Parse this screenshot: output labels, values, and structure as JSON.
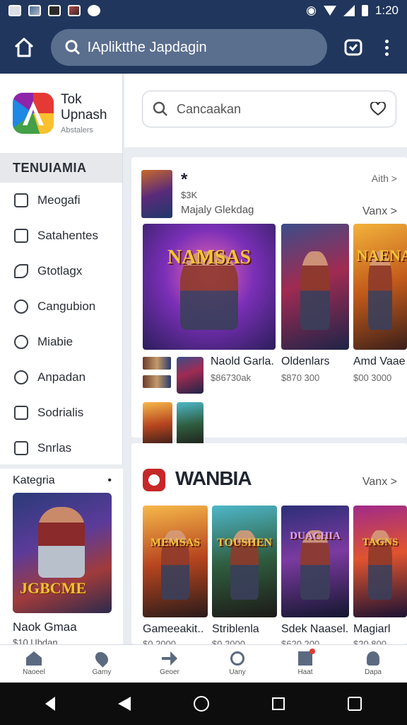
{
  "status": {
    "time": "1:20"
  },
  "appbar": {
    "search_text": "IApliktthe Japdagin"
  },
  "sidebar": {
    "brand_name_line1": "Tok",
    "brand_name_line2": "Upnash",
    "brand_sub": "Abstalers",
    "menu_title": "TENUIAMIA",
    "items": [
      {
        "label": "Meogafi",
        "icon": "checkbox-icon"
      },
      {
        "label": "Satahentes",
        "icon": "square-minus-icon"
      },
      {
        "label": "Gtotlagx",
        "icon": "pen-icon"
      },
      {
        "label": "Cangubion",
        "icon": "clock-icon"
      },
      {
        "label": "Miabie",
        "icon": "search-icon"
      },
      {
        "label": "Anpadan",
        "icon": "cloud-icon"
      },
      {
        "label": "Sodrialis",
        "icon": "dot-square-icon"
      },
      {
        "label": "Snrlas",
        "icon": "tag-icon"
      }
    ],
    "category": {
      "title": "Kategria",
      "cover_title": "JGBCME",
      "name": "Naok Gmaa",
      "price": "$10 Ubdan"
    }
  },
  "main": {
    "search_placeholder": "Cancaakan",
    "section1": {
      "title": "*",
      "subtitle": "$3K",
      "meta": "Majaly Glekdag",
      "more_top": "Aith >",
      "more": "Vanx >",
      "games": [
        {
          "art": "NAMSAS",
          "name": "Naold Garla.",
          "price": "$86730ak"
        },
        {
          "art": "",
          "name": "Oldenlars",
          "price": "$870 300"
        },
        {
          "art": "NAENA",
          "name": "Amd Vaae",
          "price": "$00 3000"
        }
      ]
    },
    "section2": {
      "title": "WANBIA",
      "more": "Vanx >",
      "games": [
        {
          "art": "MEMSAS",
          "name": "Gameeakit..",
          "price": "$0 2000"
        },
        {
          "art": "TOUSHEN",
          "name": "Striblenla",
          "price": "$0 2000"
        },
        {
          "art": "DUACHIA",
          "name": "Sdek Naasel.",
          "price": "$620 200"
        },
        {
          "art": "TAGNS",
          "name": "Magiarl",
          "price": "$20 800"
        }
      ]
    }
  },
  "bottom_nav": [
    {
      "label": "Naoeel",
      "icon": "home-icon"
    },
    {
      "label": "Gamy",
      "icon": "location-icon"
    },
    {
      "label": "Geoer",
      "icon": "arrow-icon"
    },
    {
      "label": "Uany",
      "icon": "search-icon"
    },
    {
      "label": "Haat",
      "icon": "notification-icon"
    },
    {
      "label": "Dapa",
      "icon": "profile-icon"
    }
  ]
}
